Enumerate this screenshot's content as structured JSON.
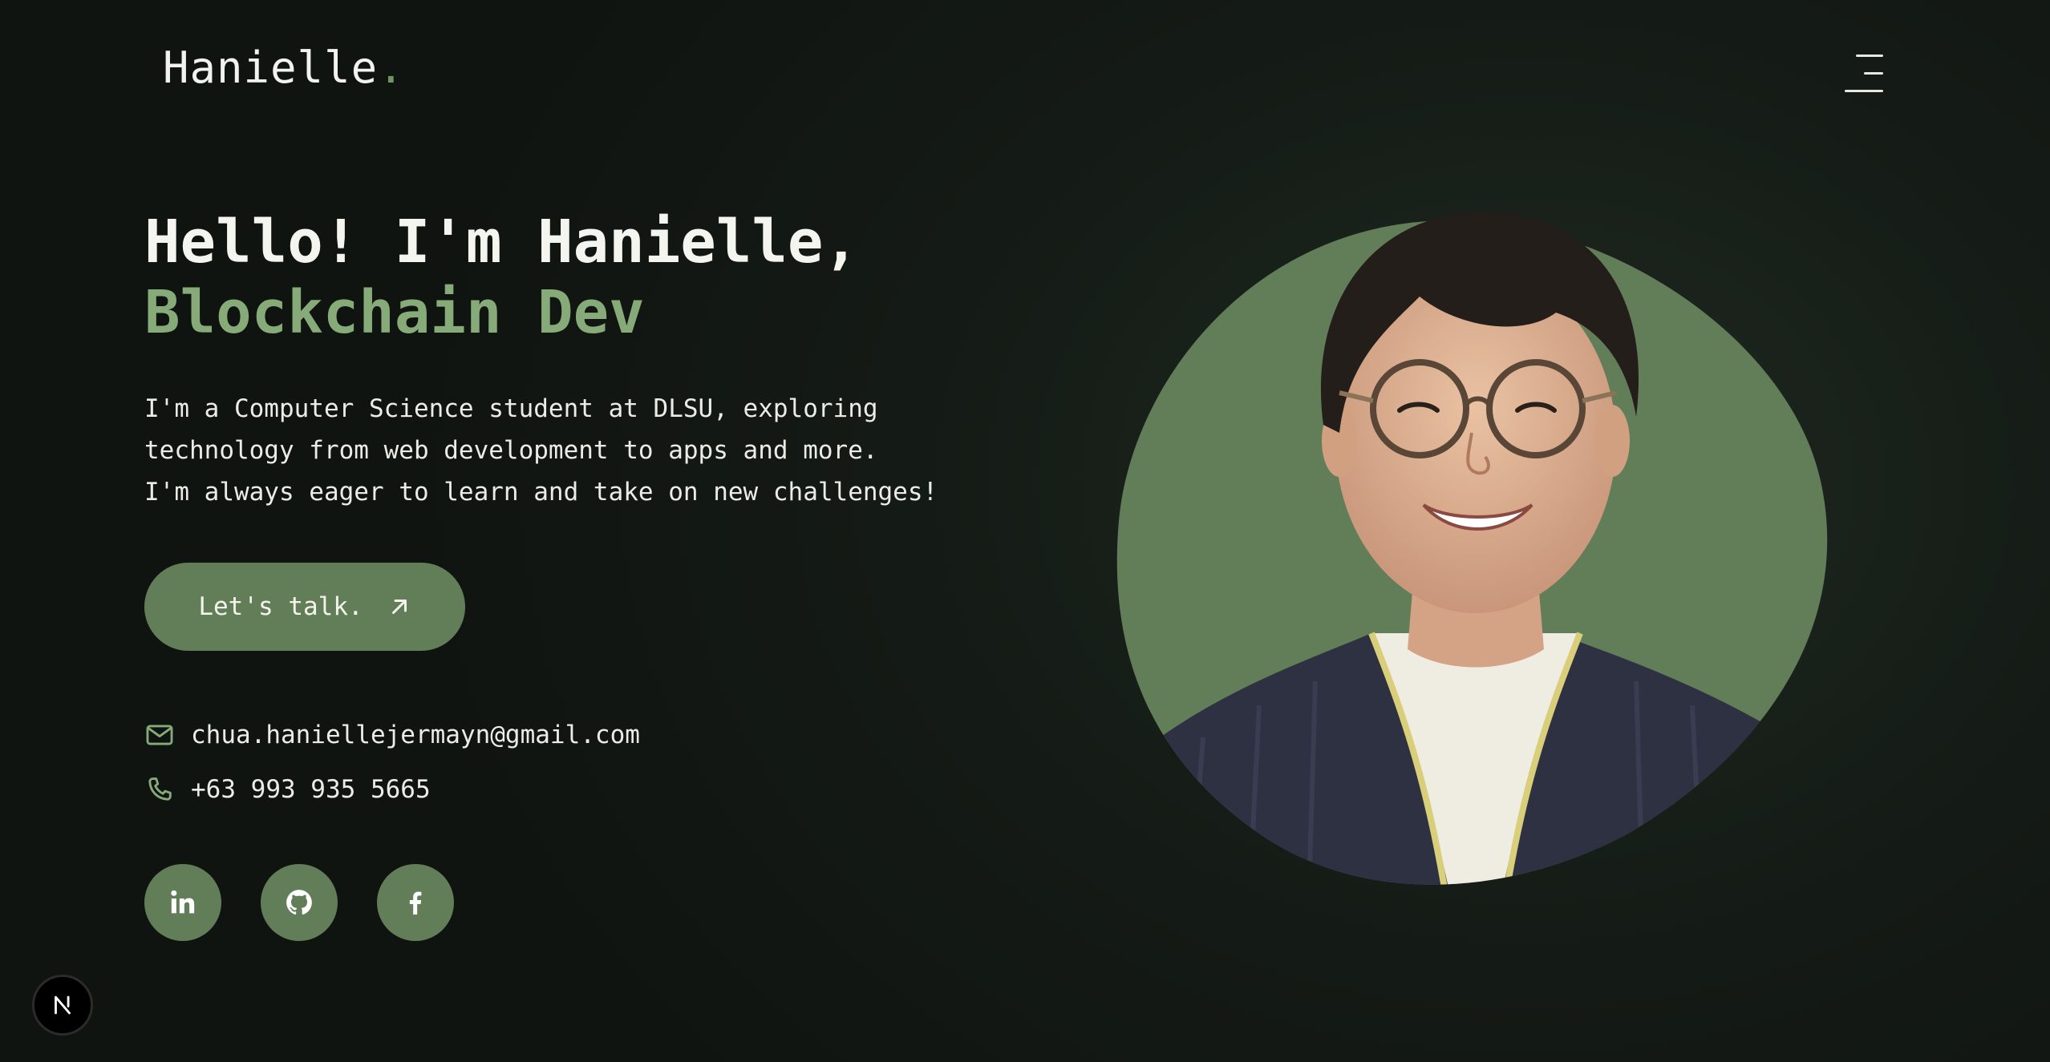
{
  "header": {
    "logo_text": "Hanielle",
    "logo_dot": ".",
    "menu_icon": "hamburger-menu-icon"
  },
  "hero": {
    "greeting": "Hello! I'm Hanielle,",
    "role": "Blockchain Dev",
    "intro_lines": [
      "I'm a Computer Science student at DLSU, exploring",
      "technology from web development to apps and more.",
      "I'm always eager to learn and take on new challenges!"
    ],
    "cta_label": "Let's talk.",
    "cta_icon": "arrow-up-right-icon"
  },
  "contact": {
    "email": "chua.haniellejermayn@gmail.com",
    "email_icon": "mail-icon",
    "phone": "+63 993 935 5665",
    "phone_icon": "phone-icon"
  },
  "socials": [
    {
      "icon": "linkedin-icon"
    },
    {
      "icon": "github-icon"
    },
    {
      "icon": "facebook-icon"
    }
  ],
  "badge": {
    "text": "N",
    "icon": "nextjs-icon"
  },
  "colors": {
    "background": "#141a15",
    "accent": "#86ab78",
    "button": "#627e58",
    "text": "#f2f2ee"
  }
}
